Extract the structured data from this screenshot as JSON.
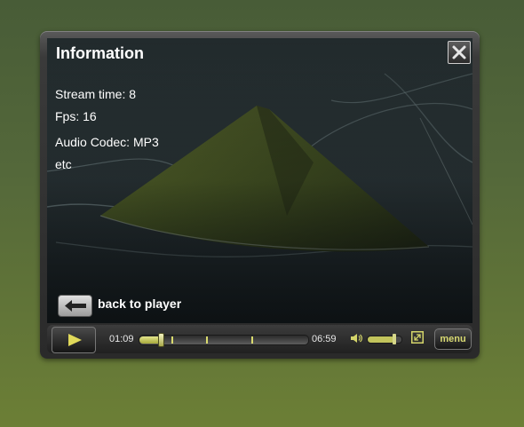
{
  "info_panel": {
    "title": "Information",
    "lines": [
      "Stream time: 8",
      "Fps: 16",
      "Audio Codec: MP3",
      "etc"
    ],
    "back_label": "back to player"
  },
  "controls": {
    "current_time": "01:09",
    "total_time": "06:59",
    "progress_fraction": 0.1,
    "volume_fraction": 0.8,
    "menu_label": "menu"
  },
  "icons": {
    "close": "close-icon",
    "back": "arrow-left-icon",
    "play": "play-icon",
    "volume": "speaker-icon",
    "fullscreen": "fullscreen-icon"
  },
  "colors": {
    "accent": "#d4d56a",
    "background_top": "#485c37",
    "background_bottom": "#6c7f36"
  }
}
